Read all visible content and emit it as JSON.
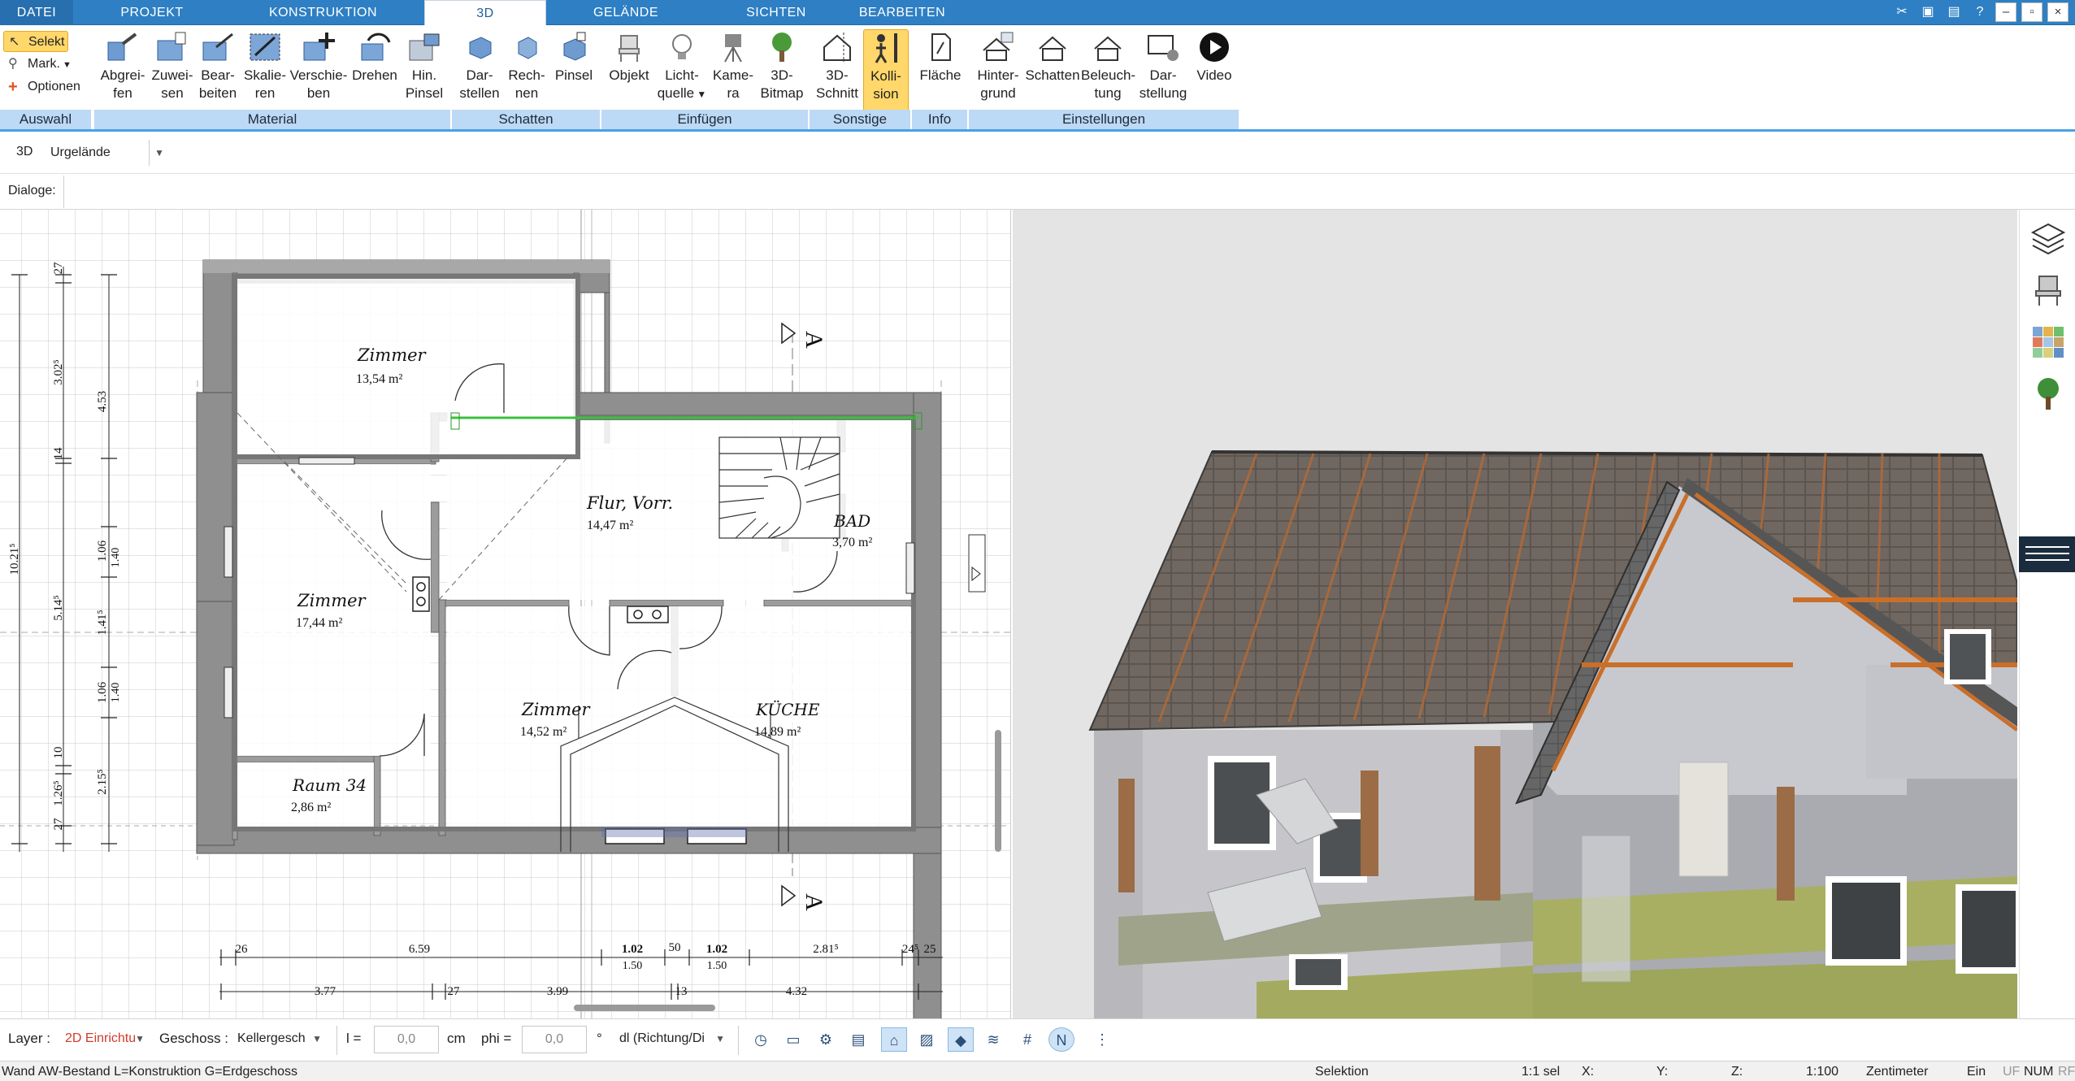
{
  "tabs": {
    "datei": "DATEI",
    "projekt": "PROJEKT",
    "konstruktion": "KONSTRUKTION",
    "d3": "3D",
    "gelaende": "GELÄNDE",
    "sichten": "SICHTEN",
    "bearbeiten": "BEARBEITEN"
  },
  "ribbon": {
    "auswahl": {
      "selekt": "Selekt",
      "mark": "Mark.",
      "optionen": "Optionen",
      "group": "Auswahl"
    },
    "material": {
      "group": "Material",
      "buttons": [
        {
          "l1": "Abgrei-",
          "l2": "fen"
        },
        {
          "l1": "Zuwei-",
          "l2": "sen"
        },
        {
          "l1": "Bear-",
          "l2": "beiten"
        },
        {
          "l1": "Skalie-",
          "l2": "ren"
        },
        {
          "l1": "Verschie-",
          "l2": "ben"
        },
        {
          "l1": "Drehen",
          "l2": ""
        },
        {
          "l1": "Hin.",
          "l2": "Pinsel"
        }
      ]
    },
    "schatten": {
      "group": "Schatten",
      "buttons": [
        {
          "l1": "Dar-",
          "l2": "stellen"
        },
        {
          "l1": "Rech-",
          "l2": "nen"
        },
        {
          "l1": "Pinsel",
          "l2": ""
        }
      ]
    },
    "einfuegen": {
      "group": "Einfügen",
      "buttons": [
        {
          "l1": "Objekt",
          "l2": ""
        },
        {
          "l1": "Licht-",
          "l2": "quelle"
        },
        {
          "l1": "Kame-",
          "l2": "ra"
        },
        {
          "l1": "3D-",
          "l2": "Bitmap"
        }
      ]
    },
    "sonstige": {
      "group": "Sonstige",
      "buttons": [
        {
          "l1": "3D-",
          "l2": "Schnitt"
        },
        {
          "l1": "Kolli-",
          "l2": "sion"
        }
      ]
    },
    "info": {
      "group": "Info",
      "buttons": [
        {
          "l1": "Fläche",
          "l2": ""
        }
      ]
    },
    "einstellungen": {
      "group": "Einstellungen",
      "buttons": [
        {
          "l1": "Hinter-",
          "l2": "grund"
        },
        {
          "l1": "Schatten",
          "l2": ""
        },
        {
          "l1": "Beleuch-",
          "l2": "tung"
        },
        {
          "l1": "Dar-",
          "l2": "stellung"
        },
        {
          "l1": "Video",
          "l2": ""
        }
      ]
    }
  },
  "toolbar": {
    "mode": "3D",
    "terrain": "Urgelände",
    "dialoge": "Dialoge:"
  },
  "plan": {
    "rooms": [
      {
        "name": "Zimmer",
        "area": "13,54 m²"
      },
      {
        "name": "Flur, Vorr.",
        "area": "14,47 m²"
      },
      {
        "name": "BAD",
        "area": "3,70 m²"
      },
      {
        "name": "Zimmer",
        "area": "17,44 m²"
      },
      {
        "name": "Zimmer",
        "area": "14,52 m²"
      },
      {
        "name": "KÜCHE",
        "area": "14,89 m²"
      },
      {
        "name": "Raum 34",
        "area": "2,86 m²"
      }
    ],
    "section_mark": "A",
    "dims_bottom_top": [
      "26",
      "6.59",
      "1.02",
      "1.50",
      "50",
      "1.02",
      "1.50",
      "2.81⁵",
      "24⁵",
      "25"
    ],
    "dims_bottom_low": [
      "3.77",
      "27",
      "3.99",
      "13",
      "4.32"
    ],
    "dims_left_outer": "10.21⁵",
    "dims_left_mid": [
      "27",
      "3.02⁵",
      "14",
      "5.14⁵",
      "10",
      "1.26⁵",
      "27"
    ],
    "dims_left_inner": [
      "4.53",
      "1.06",
      "1.40",
      "1.41⁵",
      "1.06",
      "1.40",
      "2.15⁵"
    ]
  },
  "bottom": {
    "layer_label": "Layer :",
    "layer_value": "2D Einrichtu",
    "geschoss_label": "Geschoss :",
    "geschoss_value": "Kellergesch",
    "l_label": "l =",
    "l_value": "0,0",
    "cm": "cm",
    "phi_label": "phi =",
    "phi_value": "0,0",
    "deg": "°",
    "dl_value": "dl (Richtung/Di"
  },
  "status": {
    "left": "Wand AW-Bestand L=Konstruktion G=Erdgeschoss",
    "mode": "Selektion",
    "sel": "1:1 sel",
    "x": "X:",
    "y": "Y:",
    "z": "Z:",
    "scale": "1:100",
    "unit": "Zentimeter",
    "ein": "Ein",
    "uf": "UF",
    "num": "NUM",
    "rf": "RF"
  },
  "colors": {
    "ribbon_blue": "#2e7fc4",
    "group_blue": "#bcd9f5",
    "active_yellow": "#ffd76a"
  }
}
